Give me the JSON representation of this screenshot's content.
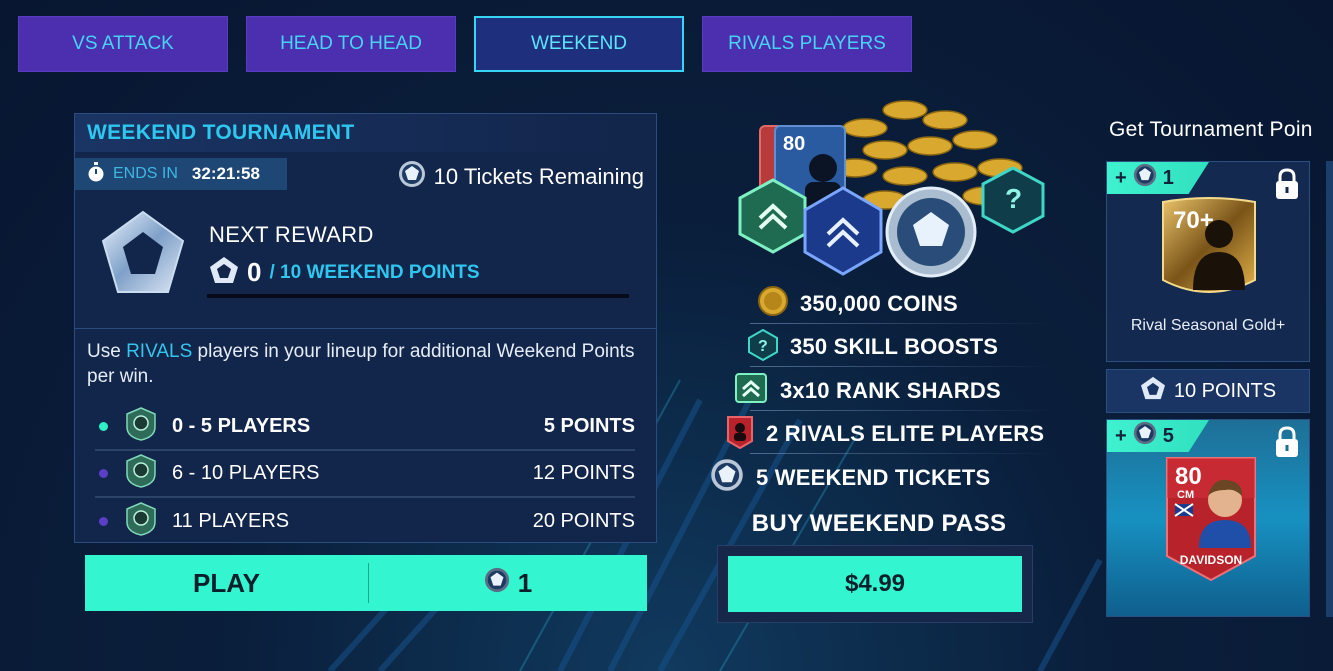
{
  "tabs": [
    {
      "label": "VS ATTACK",
      "active": false
    },
    {
      "label": "HEAD TO HEAD",
      "active": false
    },
    {
      "label": "WEEKEND",
      "active": true
    },
    {
      "label": "RIVALS PLAYERS",
      "active": false
    }
  ],
  "tournament": {
    "title": "WEEKEND TOURNAMENT",
    "ends_label": "ENDS IN",
    "ends_time": "32:21:58",
    "tickets_text": "10 Tickets Remaining",
    "next_reward_label": "NEXT REWARD",
    "points_value": "0",
    "points_target": "/ 10 WEEKEND POINTS",
    "progress_fraction": 0,
    "note_prefix": "Use ",
    "note_highlight": "RIVALS",
    "note_suffix": " players in your lineup for additional Weekend Points per win.",
    "tiers": [
      {
        "name": "0 - 5 PLAYERS",
        "points": "5 POINTS",
        "active": true
      },
      {
        "name": "6 - 10 PLAYERS",
        "points": "12 POINTS",
        "active": false
      },
      {
        "name": "11 PLAYERS",
        "points": "20 POINTS",
        "active": false
      }
    ],
    "play_label": "PLAY",
    "play_cost": "1"
  },
  "weekend_pass": {
    "items": [
      {
        "text": "350,000 COINS",
        "icon": "coin-icon"
      },
      {
        "text": "350 SKILL BOOSTS",
        "icon": "skill-boost-icon"
      },
      {
        "text": "3x10 RANK SHARDS",
        "icon": "rank-shard-icon"
      },
      {
        "text": "2 RIVALS ELITE PLAYERS",
        "icon": "player-card-icon"
      },
      {
        "text": "5 WEEKEND TICKETS",
        "icon": "ticket-icon"
      }
    ],
    "pack_card_rating": "80",
    "buy_title": "BUY WEEKEND PASS",
    "price": "$4.99"
  },
  "tournament_points": {
    "title": "Get Tournament Poin",
    "cards": [
      {
        "ribbon_value": "1",
        "card_rating": "70+",
        "caption": "Rival Seasonal Gold+"
      },
      {
        "ribbon_value": "5",
        "player_rating": "80",
        "player_position": "CM",
        "player_name": "DAVIDSON"
      }
    ],
    "points_band": "10 POINTS"
  },
  "colors": {
    "accent": "#33f5cf",
    "cyan_text": "#2ec7ef",
    "tab_bg": "#4b2fae",
    "panel_bg": "#12254a"
  }
}
